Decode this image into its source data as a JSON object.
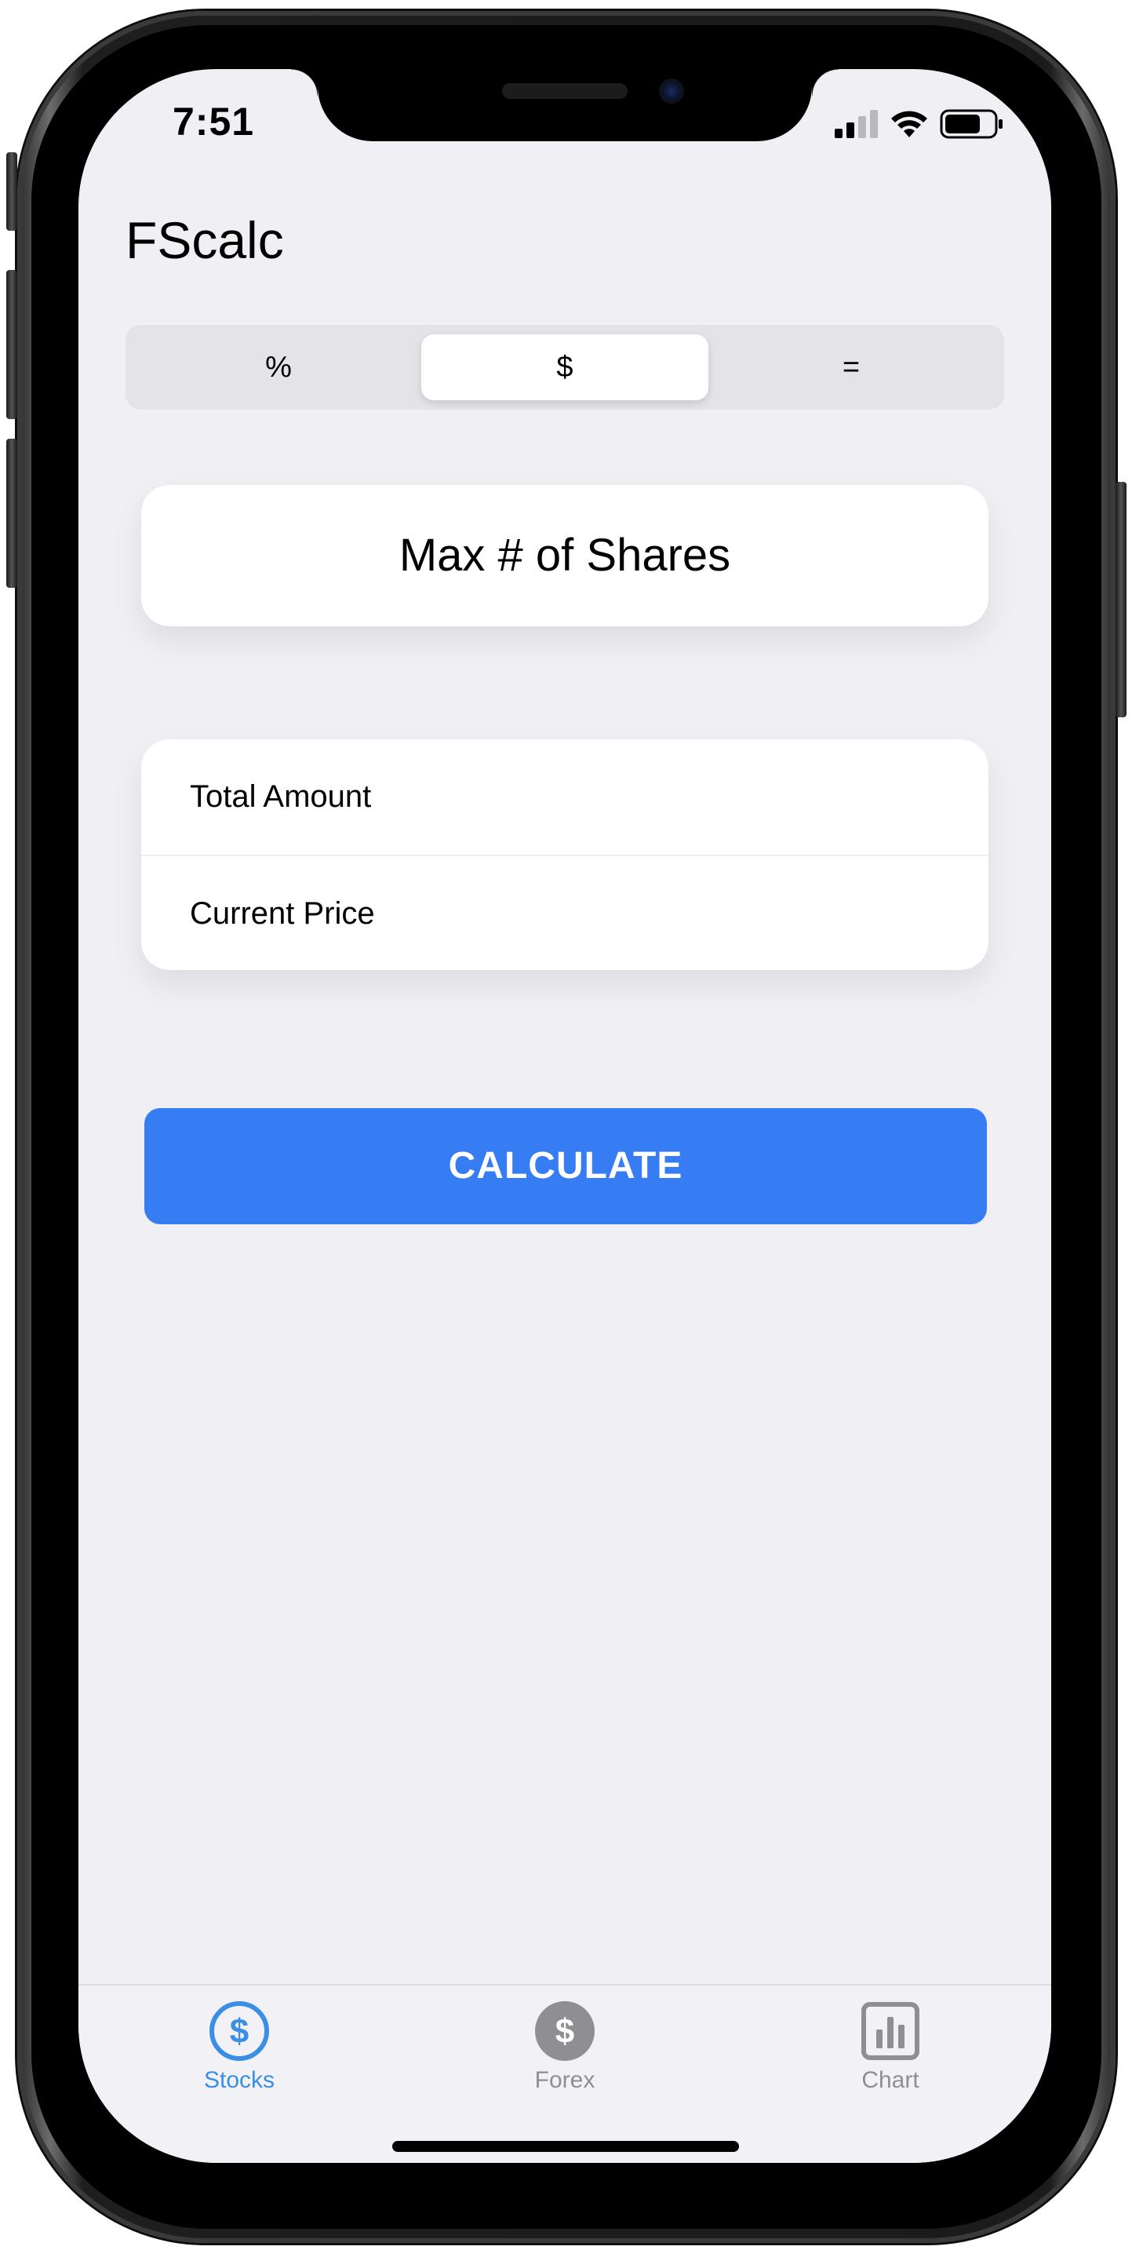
{
  "status_bar": {
    "time": "7:51",
    "icons": [
      "cellular-signal-icon",
      "wifi-icon",
      "battery-icon"
    ]
  },
  "app": {
    "title": "FScalc"
  },
  "segmented_control": {
    "segments": [
      {
        "label": "%",
        "selected": false
      },
      {
        "label": "$",
        "selected": true
      },
      {
        "label": "=",
        "selected": false
      }
    ]
  },
  "main": {
    "card_title": "Max # of Shares",
    "fields": [
      {
        "placeholder": "Total Amount",
        "value": ""
      },
      {
        "placeholder": "Current Price",
        "value": ""
      }
    ],
    "calculate_label": "CALCULATE"
  },
  "tab_bar": {
    "tabs": [
      {
        "label": "Stocks",
        "icon": "dollar-circle-icon",
        "active": true
      },
      {
        "label": "Forex",
        "icon": "dollar-filled-circle-icon",
        "active": false
      },
      {
        "label": "Chart",
        "icon": "bar-chart-icon",
        "active": false
      }
    ]
  },
  "colors": {
    "accent": "#367cf3",
    "tab_active": "#3a8ee6",
    "tab_inactive": "#8e8e93",
    "background": "#efeff4"
  }
}
